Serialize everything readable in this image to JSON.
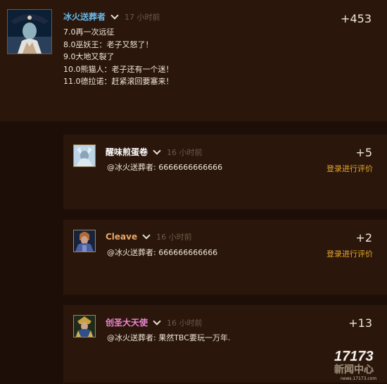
{
  "post": {
    "author": "冰火送葬者",
    "author_color": "#67b9ea",
    "time": "17 小时前",
    "score": "+453",
    "lines": [
      "7.0再一次远征",
      "8.0巫妖王：老子又怒了！",
      "9.0大地又裂了",
      "10.0熊猫人：老子还有一个迷！",
      "11.0德拉诺：赶紧滚回要塞来！"
    ]
  },
  "replies": [
    {
      "author": "醒味煎蛋卷",
      "author_color": "#ffffff",
      "time": "16 小时前",
      "text": "@冰火送葬者: 6666666666666",
      "score": "+5",
      "rate_label": "登录进行评价"
    },
    {
      "author": "Cleave",
      "author_color": "#e7a867",
      "time": "16 小时前",
      "text": "@冰火送葬者: 666666666666",
      "score": "+2",
      "rate_label": "登录进行评价"
    },
    {
      "author": "创圣大天使",
      "author_color": "#ee86d3",
      "time": "16 小时前",
      "text": "@冰火送葬者: 果然TBC要玩一万年.",
      "score": "+13",
      "rate_label": ""
    }
  ],
  "watermark": {
    "logo": "17173",
    "text": "新闻中心",
    "url": "news.17173.com"
  }
}
